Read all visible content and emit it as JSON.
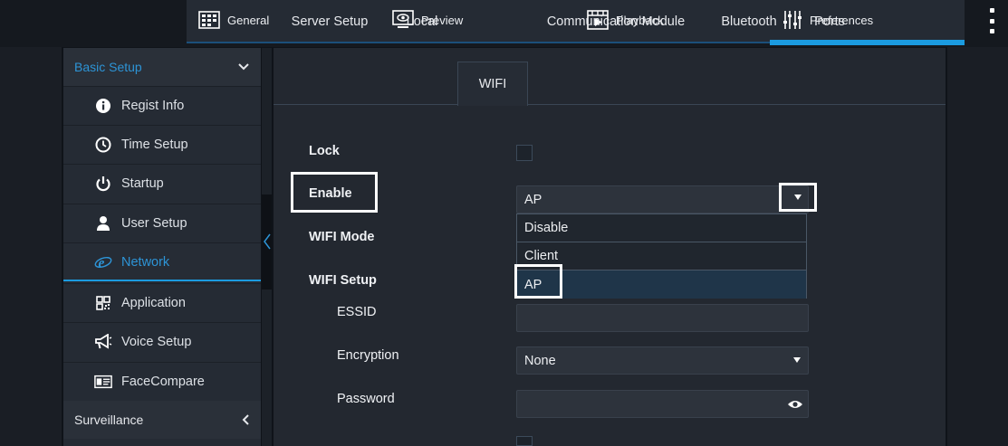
{
  "topnav": {
    "items": [
      {
        "label": "General",
        "icon": "grid-icon"
      },
      {
        "label": "Preview",
        "icon": "monitor-eye-icon"
      },
      {
        "label": "Playback",
        "icon": "film-play-icon"
      },
      {
        "label": "Preferences",
        "icon": "sliders-icon"
      }
    ],
    "active": "Preferences",
    "accent": "#1b9be0"
  },
  "sidebar": {
    "basic_setup": "Basic Setup",
    "items": [
      {
        "label": "Regist Info",
        "icon": "info-circle-icon"
      },
      {
        "label": "Time Setup",
        "icon": "clock-icon"
      },
      {
        "label": "Startup",
        "icon": "power-icon"
      },
      {
        "label": "User Setup",
        "icon": "user-icon"
      },
      {
        "label": "Network",
        "icon": "network-e-icon"
      },
      {
        "label": "Application",
        "icon": "qr-grid-icon"
      },
      {
        "label": "Voice Setup",
        "icon": "megaphone-icon"
      },
      {
        "label": "FaceCompare",
        "icon": "id-card-icon"
      }
    ],
    "active": "Network",
    "surveillance": "Surveillance"
  },
  "tabs": {
    "items": [
      "Server Setup",
      "Local",
      "WIFI",
      "Communication Module",
      "Bluetooth",
      "Ports"
    ],
    "active": "WIFI"
  },
  "form": {
    "lock_label": "Lock",
    "enable_label": "Enable",
    "enable_value": "AP",
    "enable_options": [
      "Disable",
      "Client",
      "AP"
    ],
    "wifi_mode_label": "WIFI Mode",
    "wifi_setup_label": "WIFI Setup",
    "essid_label": "ESSID",
    "essid_value": "",
    "encryption_label": "Encryption",
    "encryption_value": "None",
    "password_label": "Password",
    "password_value": ""
  }
}
